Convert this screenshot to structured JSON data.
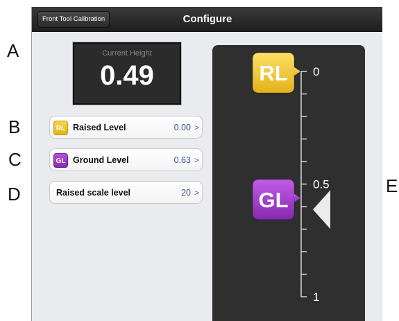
{
  "callouts": [
    "A",
    "B",
    "C",
    "D",
    "E"
  ],
  "navbar": {
    "back_label": "Front Tool Calibration",
    "title": "Configure"
  },
  "current_height": {
    "caption": "Current Height",
    "value": "0.49"
  },
  "rows": [
    {
      "badge": "RL",
      "label": "Raised Level",
      "value": "0.00",
      "chevron": ">"
    },
    {
      "badge": "GL",
      "label": "Ground Level",
      "value": "0.63",
      "chevron": ">"
    },
    {
      "label": "Raised scale level",
      "value": "20",
      "chevron": ">"
    }
  ],
  "scale": {
    "tick_labels": [
      "0",
      "0.5",
      "1"
    ],
    "rl_marker": {
      "label": "RL",
      "position": 0.0
    },
    "gl_marker": {
      "label": "GL",
      "position": 0.63
    },
    "current_pointer": 0.49
  },
  "colors": {
    "rl": "#f2c830",
    "gl": "#9b3bc6",
    "panel": "#2f2f2f",
    "navbar": "#2a2a2a",
    "value_text": "#3a5a8a"
  }
}
